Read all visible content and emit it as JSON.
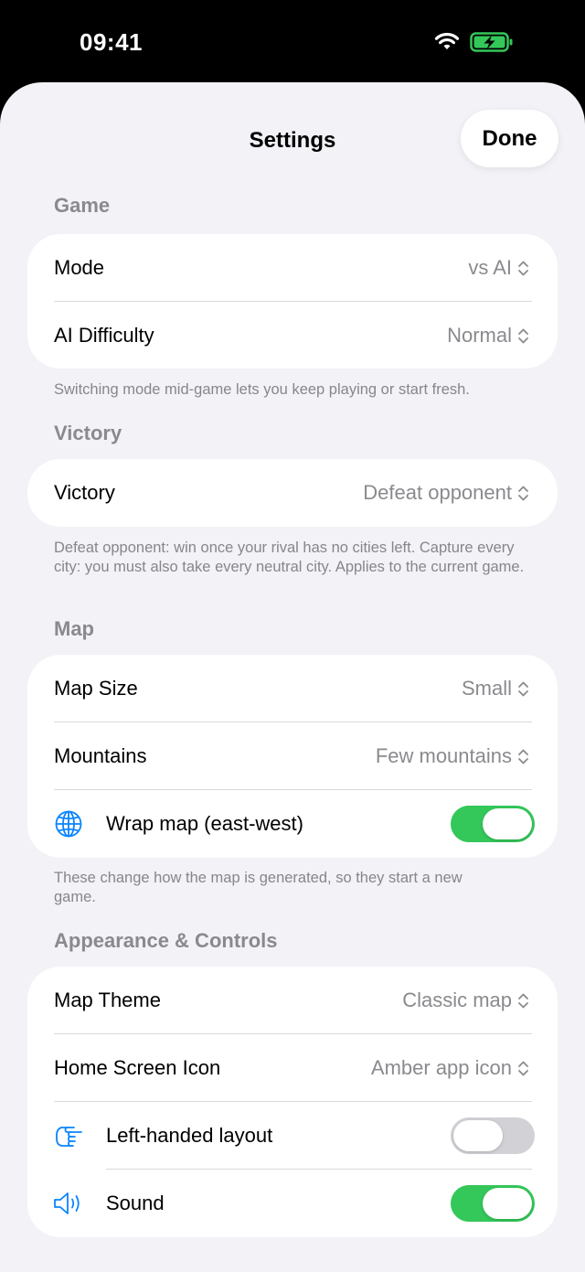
{
  "status_bar": {
    "time": "09:41"
  },
  "nav": {
    "title": "Settings",
    "done_label": "Done"
  },
  "colors": {
    "accent": "#0a84ff",
    "toggle_on": "#34c759",
    "toggle_off": "#d1d1d6",
    "battery": "#34c759"
  },
  "sections": {
    "game": {
      "header": "Game",
      "rows": [
        {
          "label": "Mode",
          "value": "vs AI"
        },
        {
          "label": "AI Difficulty",
          "value": "Normal"
        }
      ],
      "footer": "Switching mode mid-game lets you keep playing or start fresh."
    },
    "victory": {
      "header": "Victory",
      "rows": [
        {
          "label": "Victory",
          "value": "Defeat opponent"
        }
      ],
      "footer": "Defeat opponent: win once your rival has no cities left. Capture every city: you must also take every neutral city. Applies to the current game."
    },
    "map": {
      "header": "Map",
      "rows": [
        {
          "label": "Map Size",
          "value": "Small"
        },
        {
          "label": "Mountains",
          "value": "Few mountains"
        }
      ],
      "wrap": {
        "label": "Wrap map (east-west)",
        "icon": "globe-icon",
        "on": true
      },
      "footer": "These change how the map is generated, so they start a new game."
    },
    "appearance": {
      "header": "Appearance & Controls",
      "rows": [
        {
          "label": "Map Theme",
          "value": "Classic map"
        },
        {
          "label": "Home Screen Icon",
          "value": "Amber app icon"
        }
      ],
      "left_handed": {
        "label": "Left-handed layout",
        "icon": "pointing-hand-icon",
        "on": false
      },
      "sound": {
        "label": "Sound",
        "icon": "speaker-icon",
        "on": true
      }
    }
  }
}
